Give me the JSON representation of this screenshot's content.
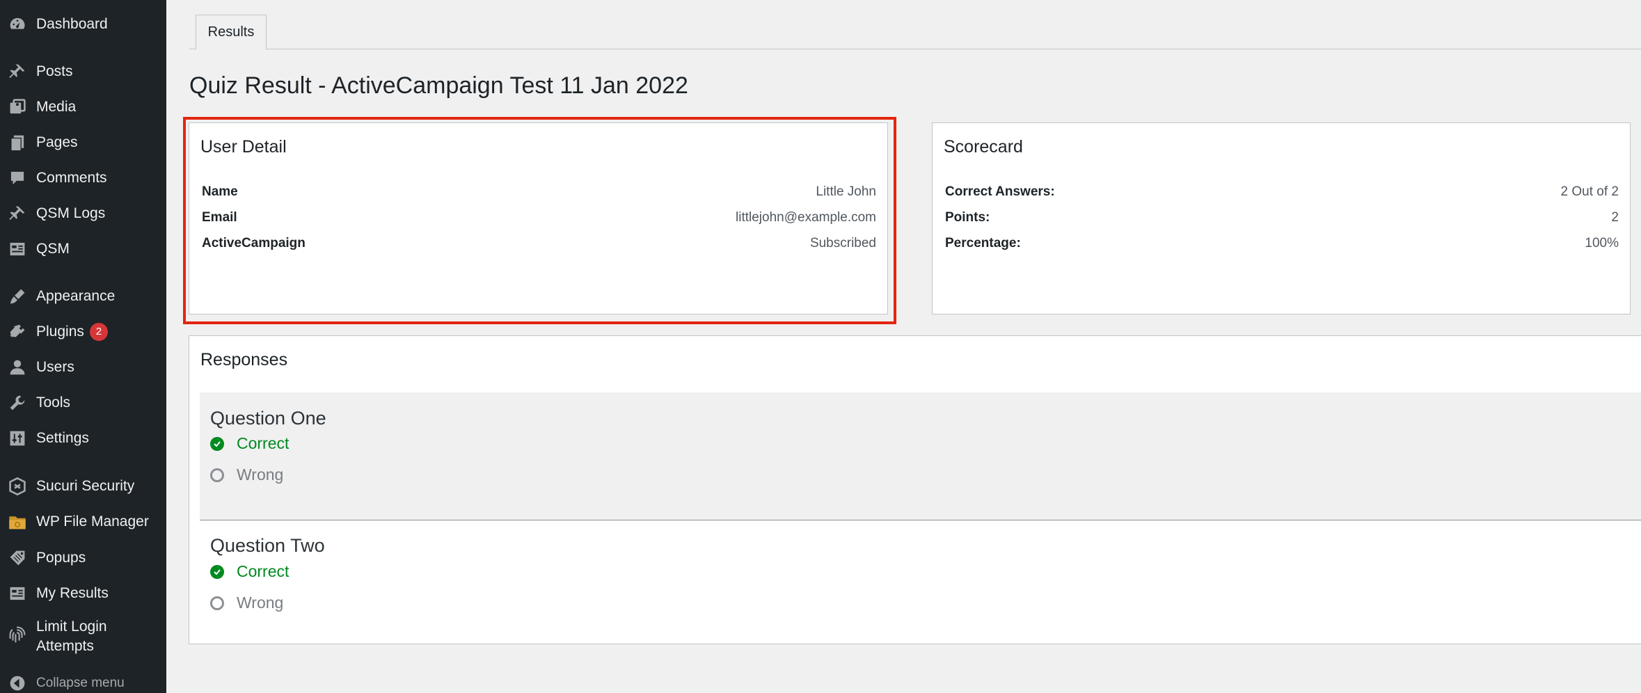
{
  "sidebar": {
    "items": [
      {
        "label": "Dashboard",
        "icon": "dashboard-icon"
      },
      {
        "label": "Posts",
        "icon": "pin-icon"
      },
      {
        "label": "Media",
        "icon": "media-icon"
      },
      {
        "label": "Pages",
        "icon": "pages-icon"
      },
      {
        "label": "Comments",
        "icon": "comment-icon"
      },
      {
        "label": "QSM Logs",
        "icon": "pin-icon"
      },
      {
        "label": "QSM",
        "icon": "table-icon"
      },
      {
        "label": "Appearance",
        "icon": "brush-icon"
      },
      {
        "label": "Plugins",
        "icon": "plug-icon",
        "badge": "2"
      },
      {
        "label": "Users",
        "icon": "user-icon"
      },
      {
        "label": "Tools",
        "icon": "wrench-icon"
      },
      {
        "label": "Settings",
        "icon": "sliders-icon"
      },
      {
        "label": "Sucuri Security",
        "icon": "shield-icon"
      },
      {
        "label": "WP File Manager",
        "icon": "folder-icon"
      },
      {
        "label": "Popups",
        "icon": "tag-icon"
      },
      {
        "label": "My Results",
        "icon": "table-icon"
      },
      {
        "label": "Limit Login Attempts",
        "icon": "fingerprint-icon"
      }
    ],
    "collapse_label": "Collapse menu"
  },
  "tab": {
    "label": "Results"
  },
  "page_title": "Quiz Result - ActiveCampaign Test 11 Jan 2022",
  "user_detail": {
    "title": "User Detail",
    "rows": [
      {
        "key": "Name",
        "value": "Little John"
      },
      {
        "key": "Email",
        "value": "littlejohn@example.com"
      },
      {
        "key": "ActiveCampaign",
        "value": "Subscribed"
      }
    ]
  },
  "scorecard": {
    "title": "Scorecard",
    "rows": [
      {
        "key": "Correct Answers:",
        "value": "2 Out of 2"
      },
      {
        "key": "Points:",
        "value": "2"
      },
      {
        "key": "Percentage:",
        "value": "100%"
      }
    ]
  },
  "responses": {
    "title": "Responses",
    "questions": [
      {
        "title": "Question One",
        "answers": [
          {
            "label": "Correct",
            "state": "correct"
          },
          {
            "label": "Wrong",
            "state": "wrong"
          }
        ]
      },
      {
        "title": "Question Two",
        "answers": [
          {
            "label": "Correct",
            "state": "correct"
          },
          {
            "label": "Wrong",
            "state": "wrong"
          }
        ]
      }
    ]
  },
  "colors": {
    "sidebar_bg": "#1d2327",
    "correct": "#008a20",
    "highlight": "#e3260f",
    "badge": "#d63638"
  }
}
